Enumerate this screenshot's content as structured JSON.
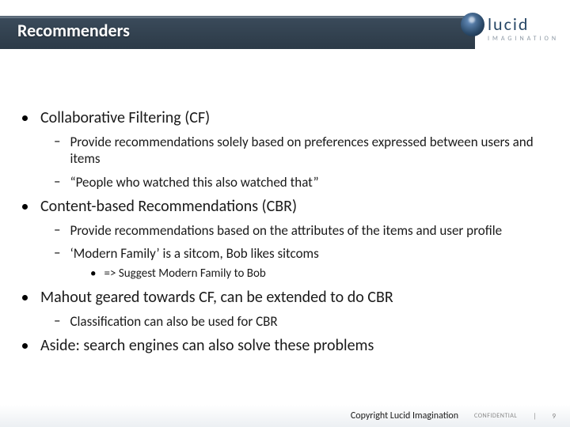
{
  "header": {
    "title": "Recommenders"
  },
  "logo": {
    "word": "lucid",
    "sub": "IMAGINATION"
  },
  "bullets": [
    {
      "text": "Collaborative Filtering (CF)",
      "children": [
        {
          "text": "Provide recommendations solely based on preferences expressed between users and items"
        },
        {
          "text": "“People who watched this also watched that”"
        }
      ]
    },
    {
      "text": "Content-based Recommendations (CBR)",
      "children": [
        {
          "text": "Provide recommendations based on the attributes of the items and user profile"
        },
        {
          "text": "‘Modern Family’ is a sitcom, Bob likes sitcoms",
          "children": [
            {
              "text": "=> Suggest Modern Family to Bob"
            }
          ]
        }
      ]
    },
    {
      "text": "Mahout geared towards CF, can be extended to do CBR",
      "children": [
        {
          "text": "Classification can also be used for CBR"
        }
      ]
    },
    {
      "text": "Aside: search engines can also solve these problems"
    }
  ],
  "footer": {
    "copyright": "Copyright Lucid Imagination",
    "confidential": "CONFIDENTIAL",
    "divider": "|",
    "page": "9"
  }
}
